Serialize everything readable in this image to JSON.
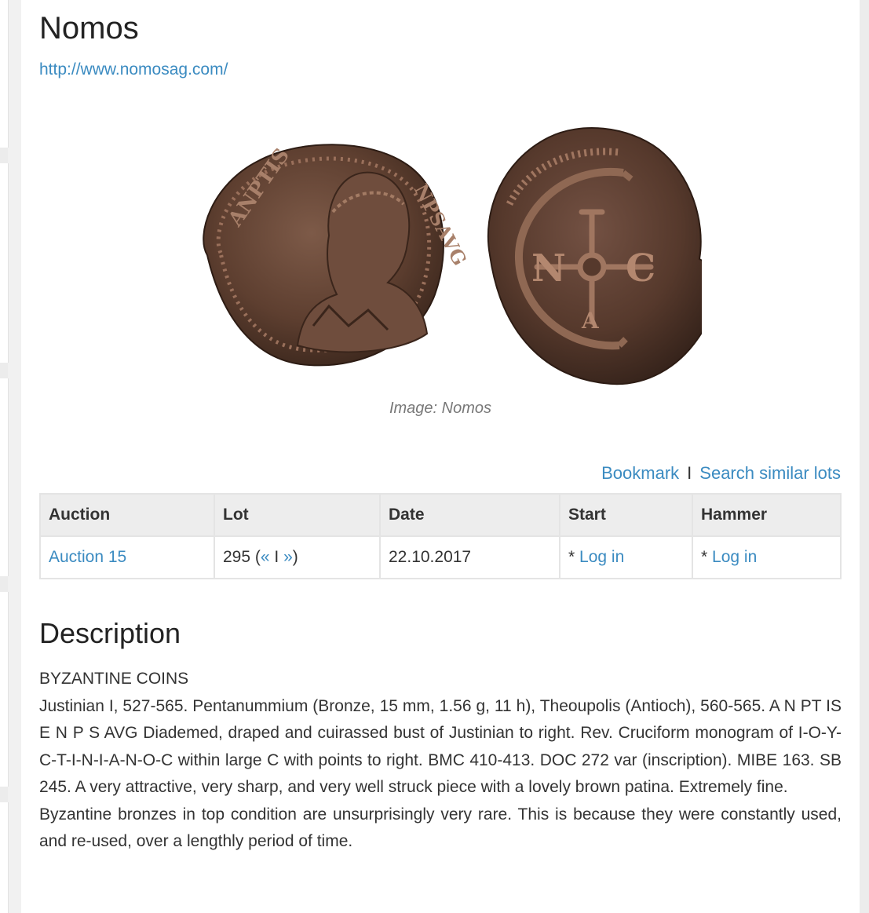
{
  "lot_page": {
    "title": "Nomos",
    "site_url": "http://www.nomosag.com/",
    "image_caption": "Image: Nomos",
    "actions": {
      "bookmark": "Bookmark",
      "separator": "I",
      "search_similar": "Search similar lots"
    },
    "table": {
      "headers": [
        "Auction",
        "Lot",
        "Date",
        "Start",
        "Hammer"
      ],
      "row": {
        "auction": "Auction 15",
        "lot_number": "295",
        "lot_nav_open": "(",
        "prev": "«",
        "nav_sep": "I",
        "next": "»",
        "lot_nav_close": ")",
        "date": "22.10.2017",
        "start_prefix": "*",
        "start_link": "Log in",
        "hammer_prefix": "*",
        "hammer_link": "Log in"
      }
    },
    "description": {
      "heading": "Description",
      "category": "BYZANTINE COINS",
      "text": "Justinian I, 527-565. Pentanummium (Bronze, 15 mm, 1.56 g, 11 h), Theoupolis (Antioch), 560-565. A N PT IS E N P S AVG Diademed, draped and cuirassed bust of Justinian to right. Rev. Cruciform monogram of I-O-Y-C-T-I-N-I-A-N-O-C within large C with points to right. BMC 410-413. DOC 272 var (inscription). MIBE 163. SB 245. A very attractive, very sharp, and very well struck piece with a lovely brown patina. Extremely fine.",
      "note": "Byzantine bronzes in top condition are unsurprisingly very rare. This is because they were constantly used, and re-used, over a lengthly period of time."
    },
    "coin_reverse_letters": {
      "left": "N",
      "right": "C",
      "bottom": "A"
    },
    "colors": {
      "link": "#3b8bc1",
      "header_bg": "#ededed",
      "coin_bronze": "#5e3f30"
    }
  }
}
